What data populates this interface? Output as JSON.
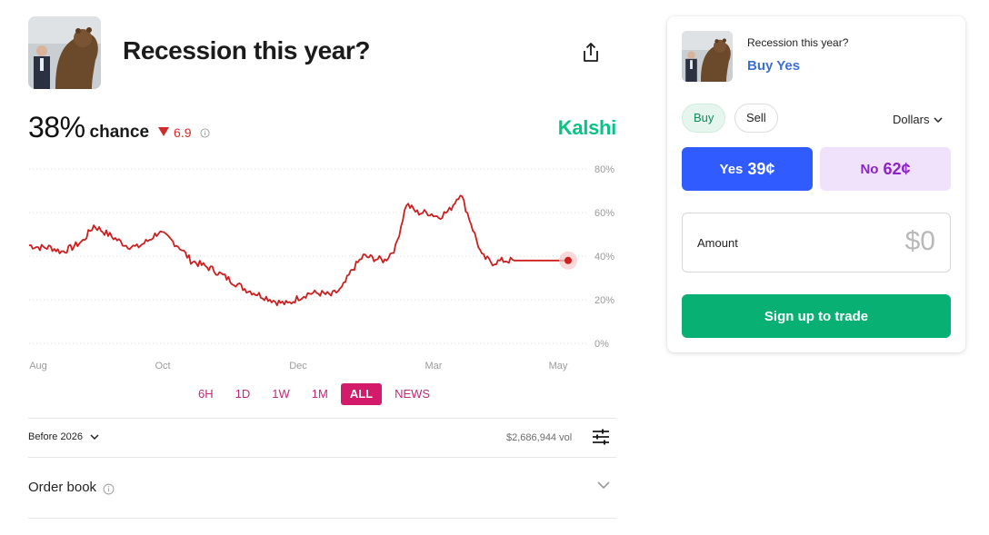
{
  "market": {
    "title": "Recession this year?",
    "image": "bear-statue-photo",
    "share_icon": "share-icon"
  },
  "summary": {
    "chance_value": "38%",
    "chance_word": "chance",
    "change": "6.9",
    "change_direction": "down",
    "change_color": "#d12c2c",
    "brand": "Kalshi",
    "brand_color": "#09c285"
  },
  "chart_data": {
    "type": "line",
    "x_tick_labels": [
      "Aug",
      "Oct",
      "Dec",
      "Mar",
      "May"
    ],
    "y_tick_labels": [
      "80%",
      "60%",
      "40%",
      "20%",
      "0%"
    ],
    "ylim": [
      0,
      80
    ],
    "grid": true,
    "legend": "none",
    "series": [
      {
        "color": "#cc1f1f",
        "x": [
          0,
          2,
          4,
          6,
          8,
          10,
          12,
          14,
          16,
          18,
          20,
          22,
          24,
          26,
          28,
          30,
          32,
          34,
          36,
          38,
          40,
          42,
          44,
          46,
          48,
          50,
          52,
          54,
          56,
          58,
          60,
          62,
          64,
          66,
          68,
          70,
          72,
          74,
          76,
          78,
          80,
          82,
          84,
          86,
          88,
          90,
          92,
          94,
          96,
          98,
          100
        ],
        "values": [
          45,
          44,
          44,
          42,
          44,
          47,
          54,
          51,
          48,
          45,
          44,
          47,
          51,
          48,
          44,
          38,
          36,
          34,
          31,
          28,
          25,
          23,
          21,
          19,
          18,
          21,
          23,
          23,
          22,
          25,
          34,
          40,
          39,
          38,
          44,
          64,
          60,
          60,
          58,
          61,
          69,
          55,
          40,
          37,
          38,
          38,
          38,
          38,
          38,
          38,
          38
        ]
      }
    ]
  },
  "range_tabs": [
    {
      "label": "6H",
      "active": false
    },
    {
      "label": "1D",
      "active": false
    },
    {
      "label": "1W",
      "active": false
    },
    {
      "label": "1M",
      "active": false
    },
    {
      "label": "ALL",
      "active": true
    },
    {
      "label": "NEWS",
      "active": false
    }
  ],
  "filters": {
    "period_label": "Before 2026",
    "volume": "$2,686,944 vol"
  },
  "order_book": {
    "label": "Order book"
  },
  "trade_card": {
    "title": "Recession this year?",
    "side_label": "Buy Yes",
    "buy_label": "Buy",
    "sell_label": "Sell",
    "units_label": "Dollars",
    "yes": {
      "label": "Yes",
      "price": "39¢"
    },
    "no": {
      "label": "No",
      "price": "62¢"
    },
    "amount_label": "Amount",
    "amount_placeholder": "$0",
    "signup_label": "Sign up to trade",
    "colors": {
      "yes_bg": "#2f5bff",
      "no_bg": "#f1e2fb",
      "signup_bg": "#08b074"
    }
  }
}
